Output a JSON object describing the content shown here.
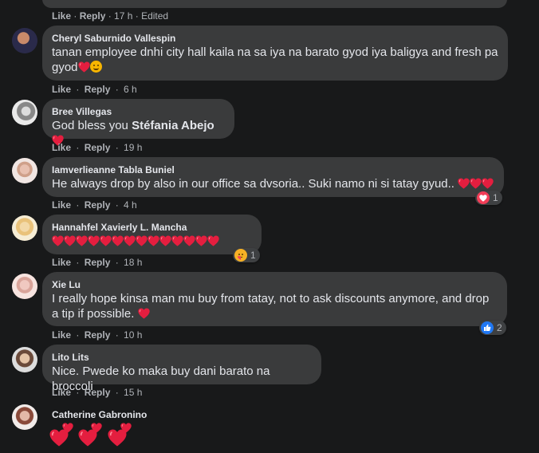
{
  "top": {
    "like": "Like",
    "reply": "Reply",
    "time": "17 h",
    "edited": "Edited"
  },
  "comments": [
    {
      "author": "Cheryl Saburnido Vallespin",
      "text1": "tanan employee dnhi city hall kaila na sa iya na barato gyod iya baligya and fresh pa",
      "text2": "gyod",
      "like": "Like",
      "reply": "Reply",
      "time": "6 h"
    },
    {
      "author": "Bree Villegas",
      "text_pre": "God bless you ",
      "text_tag": "Stéfania Abejo",
      "like": "Like",
      "reply": "Reply",
      "time": "19 h"
    },
    {
      "author": "Iamverlieanne Tabla Buniel",
      "text": "He always drop by also in our office sa dvsoria.. Suki namo ni si tatay gyud..",
      "like": "Like",
      "reply": "Reply",
      "time": "4 h",
      "reaction_count": "1"
    },
    {
      "author": "Hannahfel Xavierly L. Mancha",
      "like": "Like",
      "reply": "Reply",
      "time": "18 h",
      "reaction_count": "1"
    },
    {
      "author": "Xie Lu",
      "text1": "I really hope kinsa man mu buy from tatay, not to ask discounts anymore, and drop",
      "text2": "a tip if possible.",
      "like": "Like",
      "reply": "Reply",
      "time": "10 h",
      "reaction_count": "2"
    },
    {
      "author": "Lito Lits",
      "text": "Nice. Pwede ko maka buy dani barato na broccoli",
      "like": "Like",
      "reply": "Reply",
      "time": "15 h"
    },
    {
      "author": "Catherine Gabronino"
    }
  ],
  "colors": {
    "bubble": "#3a3b3c",
    "background": "#18191a",
    "heart": "#e41e3f",
    "like_blue": "#2078f4"
  }
}
